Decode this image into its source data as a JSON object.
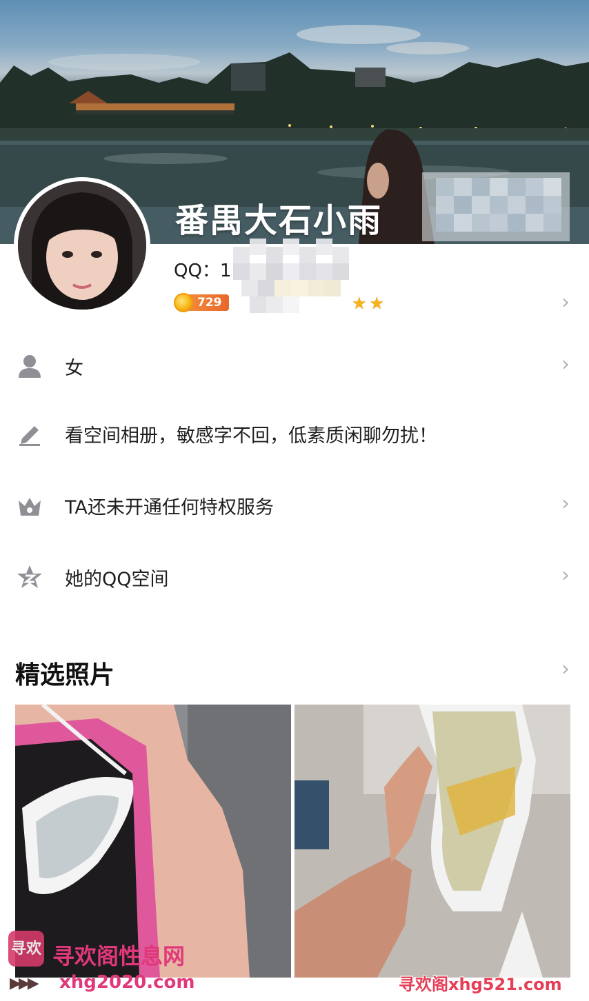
{
  "profile": {
    "nickname": "番禺大石小雨",
    "qq_label": "QQ：1",
    "level_score": "729",
    "star_glyphs": [
      "★",
      "★"
    ]
  },
  "rows": [
    {
      "label": "女",
      "icon": "person-icon",
      "has_chevron": true
    },
    {
      "label": "看空间相册，敏感字不回，低素质闲聊勿扰！",
      "icon": "pencil-icon",
      "has_chevron": false
    },
    {
      "label": "TA还未开通任何特权服务",
      "icon": "crown-icon",
      "has_chevron": true
    },
    {
      "label": "她的QQ空间",
      "icon": "qzone-star-icon",
      "has_chevron": true
    }
  ],
  "chevron_glyph": "›",
  "photos": {
    "title": "精选照片",
    "items": [
      {
        "name": "photo-goggles-shoulder"
      },
      {
        "name": "photo-goggles-hand"
      }
    ]
  },
  "watermark": {
    "logo_text": "寻欢",
    "site_name": "寻欢阁性息网",
    "arrow": "▶▶▶",
    "url_left": "xhg2020.com",
    "url_right": "寻欢阁xhg521.com"
  },
  "colors": {
    "accent_score": "#e8672b",
    "star": "#f6b21a",
    "chevron": "#b3b3b3",
    "icon": "#8f9095",
    "watermark": "#e0387a"
  }
}
